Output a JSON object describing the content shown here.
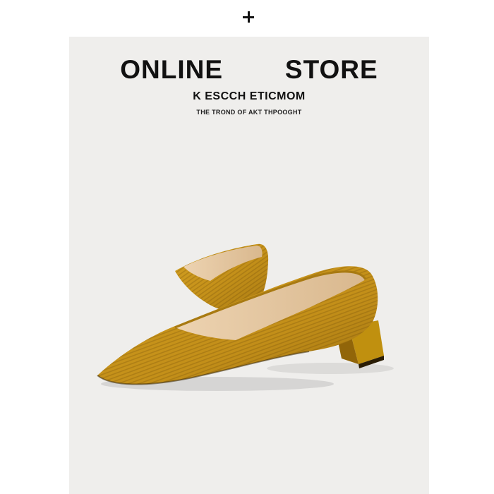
{
  "header": {
    "icon": "plus-icon"
  },
  "banner": {
    "title": "ONLINE   STORE",
    "subtitle": "K ESCCH ETICMOM",
    "tagline": "THE TROND OF AKT THPOOGHT"
  },
  "product": {
    "image_subject": "pair of mustard yellow knit pointed-toe block-heel pumps",
    "colors": {
      "shoe": "#c9961a",
      "insole": "#e6c79f",
      "background": "#efeeec"
    }
  }
}
